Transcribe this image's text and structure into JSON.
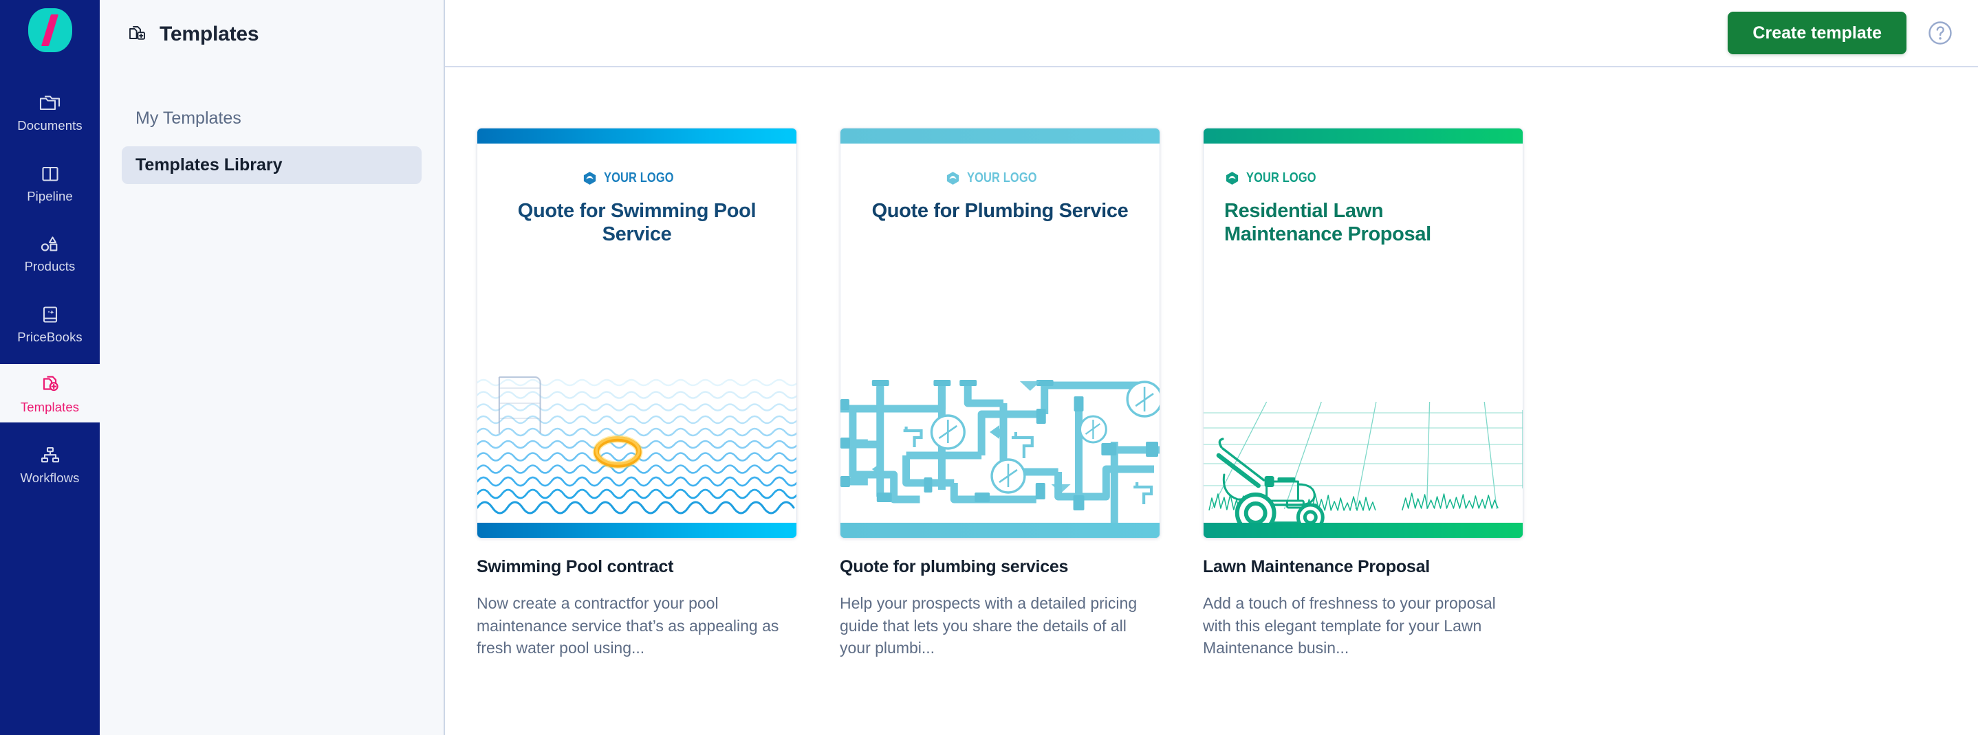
{
  "brand": {
    "logo_icon": "slash-logo-icon",
    "logo_bg": "#0ed3c5",
    "logo_mark": "#f5157c"
  },
  "rail": {
    "items": [
      {
        "label": "Documents",
        "icon": "documents-folder-icon",
        "active": false
      },
      {
        "label": "Pipeline",
        "icon": "pipeline-columns-icon",
        "active": false
      },
      {
        "label": "Products",
        "icon": "products-shapes-icon",
        "active": false
      },
      {
        "label": "PriceBooks",
        "icon": "pricebooks-book-icon",
        "active": false
      },
      {
        "label": "Templates",
        "icon": "templates-add-icon",
        "active": true
      },
      {
        "label": "Workflows",
        "icon": "workflows-hierarchy-icon",
        "active": false
      }
    ],
    "active_color": "#ec1a72",
    "bg": "#0b1f80"
  },
  "subnav": {
    "icon": "templates-add-icon",
    "title": "Templates",
    "links": [
      {
        "label": "My Templates",
        "active": false
      },
      {
        "label": "Templates Library",
        "active": true
      }
    ]
  },
  "topbar": {
    "create_button": "Create template",
    "create_button_color": "#15803b",
    "help_icon": "question-mark-circle-icon"
  },
  "templates": [
    {
      "card_title": "Swimming Pool contract",
      "description": "Now create a contractfor your pool maintenance service that’s as appealing as fresh water pool using...",
      "preview": {
        "logo_text": "YOUR LOGO",
        "logo_icon": "hexagon-swoosh-icon",
        "doc_title": "Quote for Swimming Pool Service",
        "align": "center",
        "accent_from": "#0072bb",
        "accent_to": "#00c2f5",
        "title_color": "#134a77",
        "logo_color": "#1a7fbe",
        "art": "pool-waves-ladder-float"
      }
    },
    {
      "card_title": "Quote for plumbing services",
      "description": "Help your prospects with a detailed pricing guide that lets you share the details of all your plumbi...",
      "preview": {
        "logo_text": "YOUR LOGO",
        "logo_icon": "hexagon-swoosh-icon",
        "doc_title": "Quote for Plumbing Service",
        "align": "center",
        "accent_from": "#5fc3d9",
        "accent_to": "#62c8dd",
        "title_color": "#11436c",
        "logo_color": "#6ac5dc",
        "art": "plumbing-pipes-network"
      }
    },
    {
      "card_title": "Lawn Maintenance Proposal",
      "description": "Add a touch of freshness to your proposal with this elegant template for your Lawn Maintenance busin...",
      "preview": {
        "logo_text": "YOUR LOGO",
        "logo_icon": "hexagon-swoosh-icon",
        "doc_title": "Residential Lawn Maintenance Proposal",
        "align": "left",
        "accent_from": "#069f86",
        "accent_to": "#08c871",
        "title_color": "#0b7a62",
        "logo_color": "#0f9e84",
        "art": "lawn-mower-grass"
      }
    }
  ]
}
